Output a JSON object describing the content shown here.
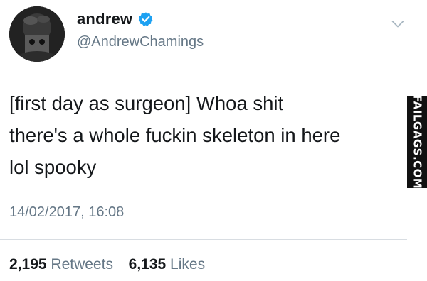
{
  "user": {
    "display_name": "andrew",
    "handle": "@AndrewChamings",
    "verified": true,
    "verified_color": "#1da1f2"
  },
  "tweet": {
    "text": "[first day as surgeon] Whoa shit\nthere's a whole fuckin skeleton in here\nlol spooky",
    "timestamp": "14/02/2017, 16:08"
  },
  "stats": {
    "retweets_count": "2,195",
    "retweets_label": "Retweets",
    "likes_count": "6,135",
    "likes_label": "Likes"
  },
  "watermark": {
    "text": "FAILGAGS.COM"
  },
  "icons": {
    "verified": "verified-badge-icon",
    "menu": "chevron-down-icon"
  }
}
